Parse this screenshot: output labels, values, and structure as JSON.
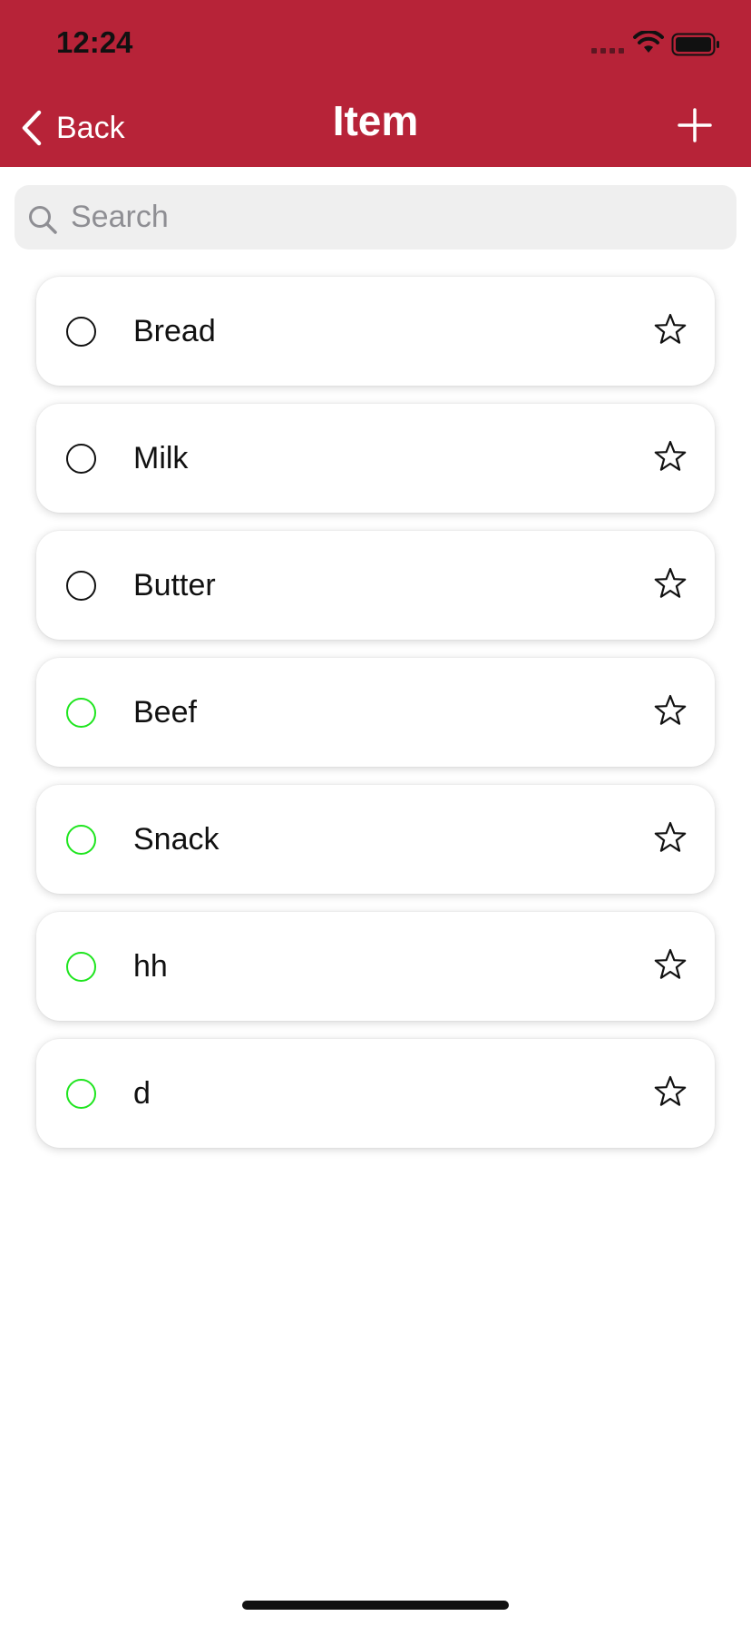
{
  "status_bar": {
    "time": "12:24",
    "icons": [
      "signal-icon",
      "wifi-icon",
      "battery-icon"
    ]
  },
  "nav": {
    "back_label": "Back",
    "title": "Item",
    "add_icon": "plus-icon"
  },
  "search": {
    "placeholder": "Search",
    "value": ""
  },
  "items": [
    {
      "label": "Bread",
      "status": "default"
    },
    {
      "label": "Milk",
      "status": "default"
    },
    {
      "label": "Butter",
      "status": "default"
    },
    {
      "label": "Beef",
      "status": "green"
    },
    {
      "label": "Snack",
      "status": "green"
    },
    {
      "label": "hh",
      "status": "green"
    },
    {
      "label": "d",
      "status": "green"
    }
  ],
  "colors": {
    "header": "#b72338",
    "green_circle": "#1ee51e",
    "default_circle": "#111111",
    "search_bg": "#efefef"
  }
}
